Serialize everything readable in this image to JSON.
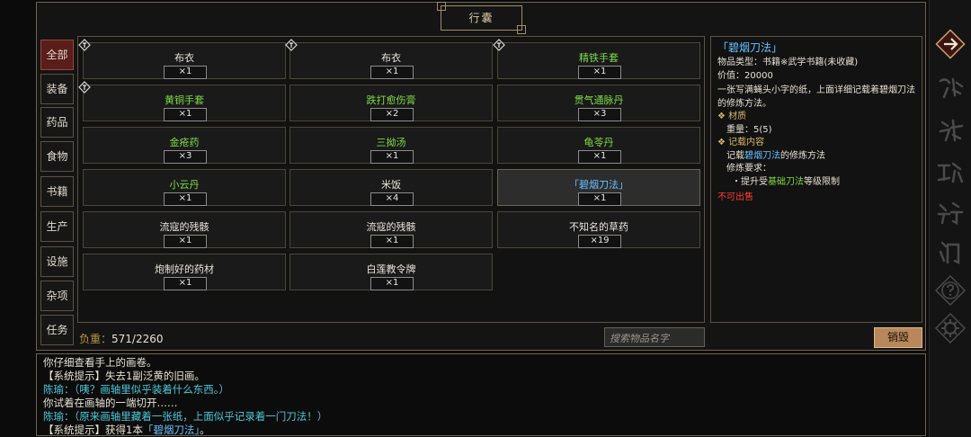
{
  "title": "行囊",
  "tabs": [
    "全部",
    "装备",
    "药品",
    "食物",
    "书籍",
    "生产",
    "设施",
    "杂项",
    "任务"
  ],
  "items": [
    {
      "name": "布衣",
      "qty": "×1",
      "color": "white",
      "equipped": true
    },
    {
      "name": "布衣",
      "qty": "×1",
      "color": "white",
      "equipped": true
    },
    {
      "name": "精铁手套",
      "qty": "×1",
      "color": "green",
      "equipped": true
    },
    {
      "name": "黄铜手套",
      "qty": "×1",
      "color": "green",
      "equipped": true
    },
    {
      "name": "跌打愈伤膏",
      "qty": "×2",
      "color": "green",
      "equipped": false
    },
    {
      "name": "贯气通脉丹",
      "qty": "×3",
      "color": "green",
      "equipped": false
    },
    {
      "name": "金疮药",
      "qty": "×3",
      "color": "green",
      "equipped": false
    },
    {
      "name": "三拗汤",
      "qty": "×1",
      "color": "green",
      "equipped": false
    },
    {
      "name": "龟苓丹",
      "qty": "×1",
      "color": "green",
      "equipped": false
    },
    {
      "name": "小云丹",
      "qty": "×1",
      "color": "green",
      "equipped": false
    },
    {
      "name": "米饭",
      "qty": "×4",
      "color": "white",
      "equipped": false
    },
    {
      "name": "「碧烟刀法」",
      "qty": "×1",
      "color": "blue",
      "equipped": false,
      "selected": true
    },
    {
      "name": "流寇的残骸",
      "qty": "×1",
      "color": "white",
      "equipped": false
    },
    {
      "name": "流寇的残骸",
      "qty": "×1",
      "color": "white",
      "equipped": false
    },
    {
      "name": "不知名的草药",
      "qty": "×19",
      "color": "white",
      "equipped": false
    },
    {
      "name": "炮制好的药材",
      "qty": "×1",
      "color": "white",
      "equipped": false
    },
    {
      "name": "白莲教令牌",
      "qty": "×1",
      "color": "white",
      "equipped": false
    }
  ],
  "weight": {
    "label": "负重：",
    "value": "571/2260"
  },
  "search": {
    "placeholder": "搜索物品名字"
  },
  "destroy_label": "销毁",
  "detail": {
    "title": "「碧烟刀法」",
    "type_line": "物品类型：书籍※武学书籍(未收藏)",
    "value_line": "价值：20000",
    "desc": "一张写满蝇头小字的纸，上面详细记载着碧烟刀法的修炼方法。",
    "material_header": "❖ 材质",
    "weight_line": "重量：5(5)",
    "record_header": "❖ 记载内容",
    "record_pre": "记载",
    "record_hl": "碧烟刀法",
    "record_post": "的修炼方法",
    "req_header": "修炼要求：",
    "req_pre": "・提升受",
    "req_hl": "基础刀法",
    "req_post": "等级限制",
    "not_for_sale": "不可出售"
  },
  "log": [
    {
      "pre": "你仔细查看手上的画卷。",
      "hl": "",
      "post": "",
      "style": "white"
    },
    {
      "pre": "【系统提示】失去1副泛黄的旧画。",
      "hl": "",
      "post": "",
      "style": "white"
    },
    {
      "pre": "陈瑜：（咦？画轴里似乎装着什么东西。）",
      "hl": "",
      "post": "",
      "style": "cyan"
    },
    {
      "pre": "你试着在画轴的一端切开……",
      "hl": "",
      "post": "",
      "style": "white"
    },
    {
      "pre": "陈瑜：（原来画轴里藏着一张纸，上面似乎记录着一门刀法！）",
      "hl": "",
      "post": "",
      "style": "cyan"
    },
    {
      "pre": "【系统提示】获得1本",
      "hl": "「碧烟刀法」",
      "post": "。",
      "style": "white"
    }
  ],
  "sidebar_icons": [
    "return-arrow-icon",
    "action-icon",
    "bag-icon",
    "work-icon",
    "martial-arts-icon",
    "sect-icon",
    "help-icon",
    "settings-gear-icon"
  ],
  "colors": {
    "green": "#7fdc45",
    "blue": "#68c0ff",
    "cyan": "#4ec8dc",
    "red": "#ff3b30",
    "gold": "#b8953f"
  }
}
